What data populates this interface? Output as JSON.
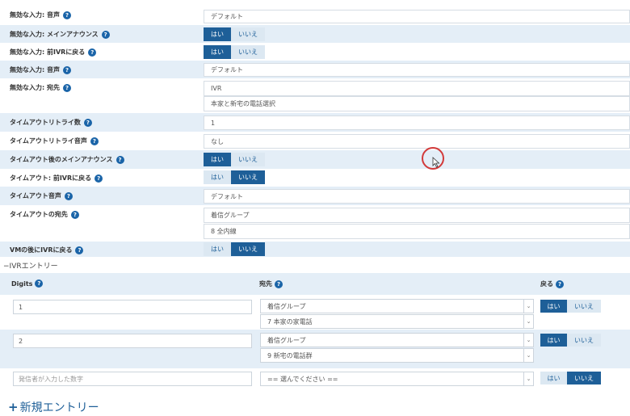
{
  "settings": [
    {
      "label": "無効な入力: 音声",
      "kind": "field",
      "values": [
        "デフォルト"
      ],
      "shade": false
    },
    {
      "label": "無効な入力: メインアナウンス",
      "kind": "toggle",
      "yes": "はい",
      "no": "いいえ",
      "selected": "yes",
      "shade": true
    },
    {
      "label": "無効な入力: 前IVRに戻る",
      "kind": "toggle",
      "yes": "はい",
      "no": "いいえ",
      "selected": "yes",
      "shade": false
    },
    {
      "label": "無効な入力: 音声",
      "kind": "field",
      "values": [
        "デフォルト"
      ],
      "shade": true
    },
    {
      "label": "無効な入力: 宛先",
      "kind": "field",
      "values": [
        "IVR",
        "本家と新宅の電話選択"
      ],
      "shade": false
    },
    {
      "label": "タイムアウトリトライ数",
      "kind": "field",
      "values": [
        "1"
      ],
      "shade": true
    },
    {
      "label": "タイムアウトリトライ音声",
      "kind": "field",
      "values": [
        "なし"
      ],
      "shade": false
    },
    {
      "label": "タイムアウト後のメインアナウンス",
      "kind": "toggle",
      "yes": "はい",
      "no": "いいえ",
      "selected": "yes",
      "shade": true
    },
    {
      "label": "タイムアウト: 前IVRに戻る",
      "kind": "toggle",
      "yes": "はい",
      "no": "いいえ",
      "selected": "no",
      "shade": false
    },
    {
      "label": "タイムアウト音声",
      "kind": "field",
      "values": [
        "デフォルト"
      ],
      "shade": true
    },
    {
      "label": "タイムアウトの宛先",
      "kind": "field",
      "values": [
        "着信グループ",
        "8 全内線"
      ],
      "shade": false
    },
    {
      "label": "VMの後にIVRに戻る",
      "kind": "toggle",
      "yes": "はい",
      "no": "いいえ",
      "selected": "no",
      "shade": true
    }
  ],
  "ivr_section": {
    "title": "IVRエントリー",
    "collapse_symbol": "−",
    "headers": {
      "digits": "Digits",
      "destination": "宛先",
      "return": "戻る"
    },
    "entries": [
      {
        "digits": "1",
        "dest_type": "着信グループ",
        "dest_target": "7 本家の家電話",
        "yes": "はい",
        "no": "いいえ",
        "selected": "yes"
      },
      {
        "digits": "2",
        "dest_type": "着信グループ",
        "dest_target": "9 新宅の電話群",
        "yes": "はい",
        "no": "いいえ",
        "selected": "yes"
      }
    ],
    "new_row": {
      "digits_placeholder": "発信者が入力した数字",
      "dest_placeholder": "== 選んでください ==",
      "yes": "はい",
      "no": "いいえ",
      "selected": "no"
    }
  },
  "new_entry": {
    "plus": "+",
    "label": "新規エントリー"
  },
  "icons": {
    "help": "question-circle-icon",
    "select_arrow": "chevron-down-icon"
  },
  "colors": {
    "accent": "#1e5f98",
    "row_shade": "#e4eef7",
    "cursor_ring": "#d23a3a"
  }
}
